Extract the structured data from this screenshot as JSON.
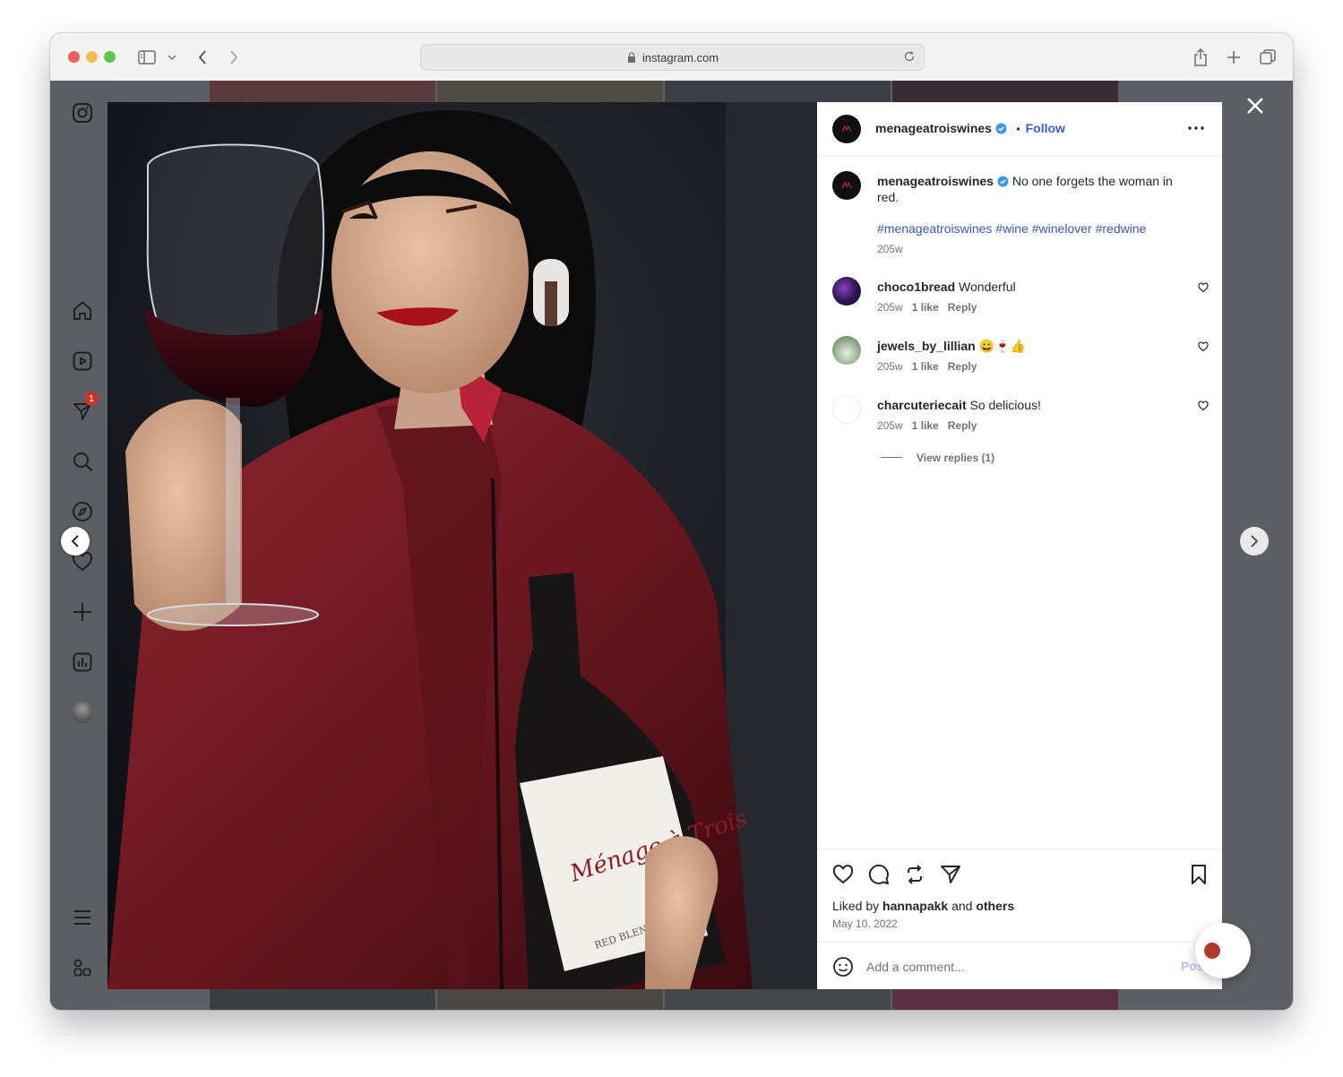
{
  "browser": {
    "url": "instagram.com",
    "colors": {
      "close": "#ee5f57",
      "minimize": "#f5bd4f",
      "zoom": "#5fc454"
    }
  },
  "sidebar": {
    "notifications_badge": "1",
    "items": [
      "instagram-icon",
      "home-icon",
      "reels-icon",
      "messages-icon",
      "search-icon",
      "explore-icon",
      "notifications-icon",
      "create-icon",
      "dashboard-icon",
      "profile-avatar",
      "menu-icon",
      "more-apps-icon"
    ]
  },
  "post": {
    "author": "menageatroiswines",
    "follow_label": "Follow",
    "dot": "•",
    "caption": "No one forgets the woman in red.",
    "hashtags": "#menageatroiswines #wine #winelover #redwine",
    "caption_age": "205w",
    "comments": [
      {
        "user": "choco1bread",
        "text": "Wonderful",
        "age": "205w",
        "likes": "1 like",
        "reply": "Reply"
      },
      {
        "user": "jewels_by_lillian",
        "text": "😀🍷👍",
        "age": "205w",
        "likes": "1 like",
        "reply": "Reply"
      },
      {
        "user": "charcuteriecait",
        "text": "So delicious!",
        "age": "205w",
        "likes": "1 like",
        "reply": "Reply"
      }
    ],
    "view_replies": "View replies (1)",
    "liked_by_prefix": "Liked by",
    "liked_by_user": "hannapakk",
    "liked_by_and": "and",
    "liked_by_others": "others",
    "date": "May 10, 2022",
    "add_comment_placeholder": "Add a comment...",
    "post_label": "Post",
    "accent": "#3b5bdb"
  }
}
